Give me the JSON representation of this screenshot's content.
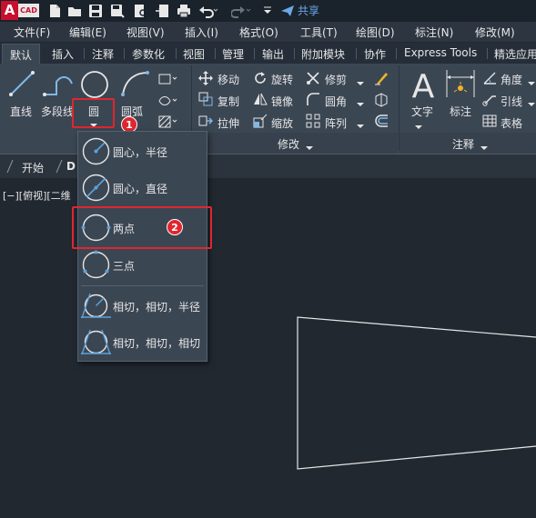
{
  "titlebar": {
    "logo_letter": "A",
    "logo_text": "CAD",
    "share_label": "共享",
    "quick_access_icons": [
      "new-file-icon",
      "open-folder-icon",
      "save-icon",
      "save-as-icon",
      "print-preview-icon",
      "publish-icon",
      "print-icon",
      "undo-icon",
      "redo-icon",
      "customize-dropdown-icon"
    ]
  },
  "menubar": {
    "items": [
      "文件(F)",
      "编辑(E)",
      "视图(V)",
      "插入(I)",
      "格式(O)",
      "工具(T)",
      "绘图(D)",
      "标注(N)",
      "修改(M)"
    ]
  },
  "ribbon_tabs": {
    "items": [
      "默认",
      "插入",
      "注释",
      "参数化",
      "视图",
      "管理",
      "输出",
      "附加模块",
      "协作",
      "Express Tools",
      "精选应用"
    ],
    "active": "默认"
  },
  "ribbon": {
    "draw": {
      "line": "直线",
      "polyline": "多段线",
      "circle": "圆",
      "arc": "圆弧"
    },
    "modify": {
      "title": "修改",
      "move": "移动",
      "rotate": "旋转",
      "trim": "修剪",
      "copy": "复制",
      "mirror": "镜像",
      "fillet": "圆角",
      "stretch": "拉伸",
      "scale": "缩放",
      "array": "阵列"
    },
    "annotation": {
      "title": "注释",
      "text": "文字",
      "dimension": "标注",
      "angle": "角度",
      "leader": "引线",
      "table": "表格"
    }
  },
  "badges": {
    "step1": "1",
    "step2": "2"
  },
  "doctabs": {
    "start": "开始",
    "drawing": "D"
  },
  "viewport": {
    "label": "[−][俯视][二维"
  },
  "circle_menu": {
    "items": [
      {
        "label": "圆心，半径",
        "icon": "circle-center-radius-icon"
      },
      {
        "label": "圆心，直径",
        "icon": "circle-center-diameter-icon"
      },
      {
        "label": "两点",
        "icon": "circle-two-point-icon"
      },
      {
        "label": "三点",
        "icon": "circle-three-point-icon"
      },
      {
        "label": "相切，相切，半径",
        "icon": "circle-tan-tan-radius-icon"
      },
      {
        "label": "相切，相切，相切",
        "icon": "circle-tan-tan-tan-icon"
      }
    ]
  },
  "colors": {
    "accent_red": "#e0262f",
    "ribbon_bg": "#3b4653",
    "canvas_bg": "#212830",
    "icon_blue": "#5ba3dc"
  }
}
